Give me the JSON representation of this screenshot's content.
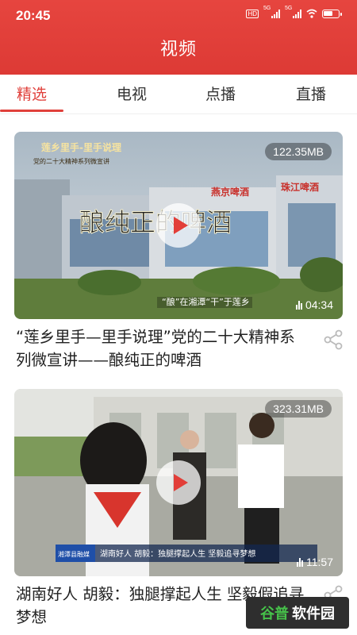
{
  "status_bar": {
    "time": "20:45",
    "hd_label": "HD",
    "network_1": "5G",
    "network_2": "5G"
  },
  "header": {
    "title": "视频"
  },
  "tabs": [
    {
      "label": "精选",
      "active": true
    },
    {
      "label": "电视",
      "active": false
    },
    {
      "label": "点播",
      "active": false
    },
    {
      "label": "直播",
      "active": false
    }
  ],
  "videos": [
    {
      "size": "122.35MB",
      "duration": "04:34",
      "title": "“莲乡里手—里手说理”党的二十大精神系列微宣讲——酿纯正的啤酒",
      "overlay": {
        "series_title": "莲乡里手-里手说理",
        "series_subtitle": "党的二十大精神系列微宣讲",
        "main_caption": "酿纯正的啤酒",
        "sub_caption": "“酿”在湘潭“干”于莲乡",
        "sign_1": "燕京啤酒",
        "sign_2": "珠江啤酒"
      }
    },
    {
      "size": "323.31MB",
      "duration": "11:57",
      "title": "湖南好人 胡毅：独腿撑起人生 坚毅假追寻梦想",
      "overlay": {
        "channel_label": "湘潭县融媒",
        "lower_third": "湖南好人 胡毅：独腿撑起人生 坚毅追寻梦想"
      }
    }
  ],
  "watermark": {
    "part_1": "谷普",
    "part_2": "软件园"
  },
  "colors": {
    "brand_red": "#e0403b",
    "header_red": "#e6453f"
  }
}
